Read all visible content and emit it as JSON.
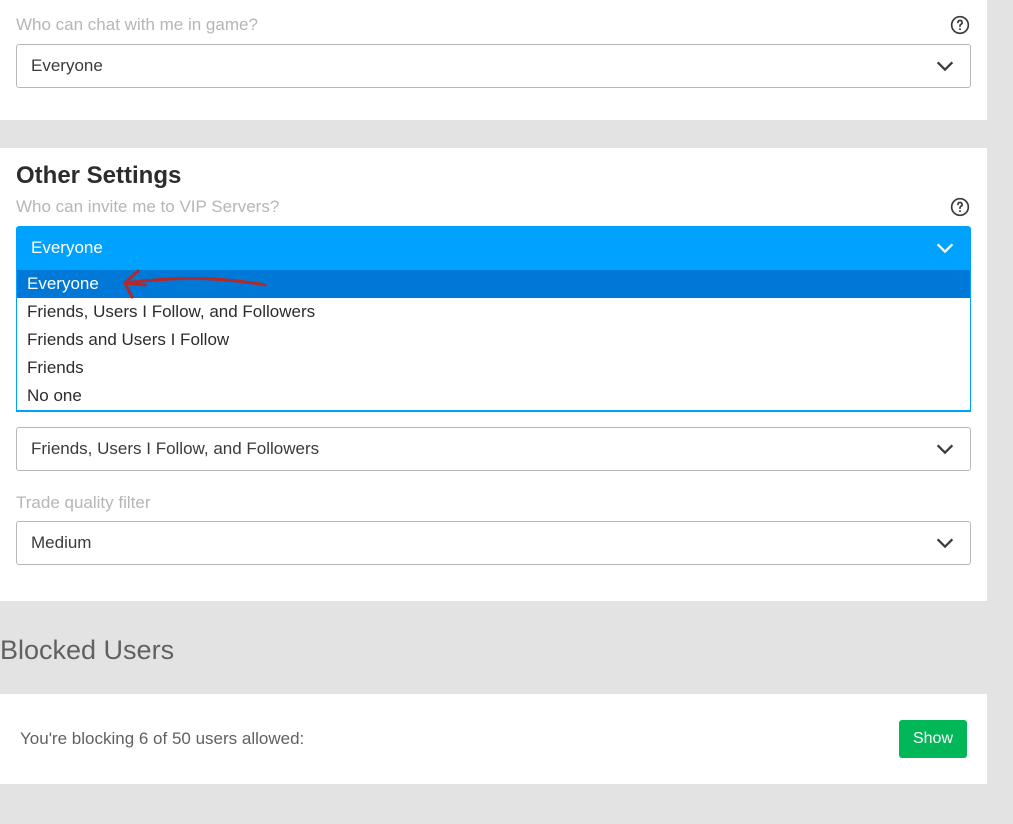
{
  "chat_section": {
    "label": "Who can chat with me in game?",
    "selected": "Everyone"
  },
  "other_settings": {
    "heading": "Other Settings",
    "vip_invite": {
      "label": "Who can invite me to VIP Servers?",
      "selected": "Everyone",
      "options": [
        "Everyone",
        "Friends, Users I Follow, and Followers",
        "Friends and Users I Follow",
        "Friends",
        "No one"
      ]
    },
    "second_setting": {
      "selected": "Friends, Users I Follow, and Followers"
    },
    "trade_filter": {
      "label": "Trade quality filter",
      "selected": "Medium"
    }
  },
  "blocked_users": {
    "heading": "Blocked Users",
    "text": "You're blocking 6 of 50 users allowed:",
    "button": "Show"
  }
}
